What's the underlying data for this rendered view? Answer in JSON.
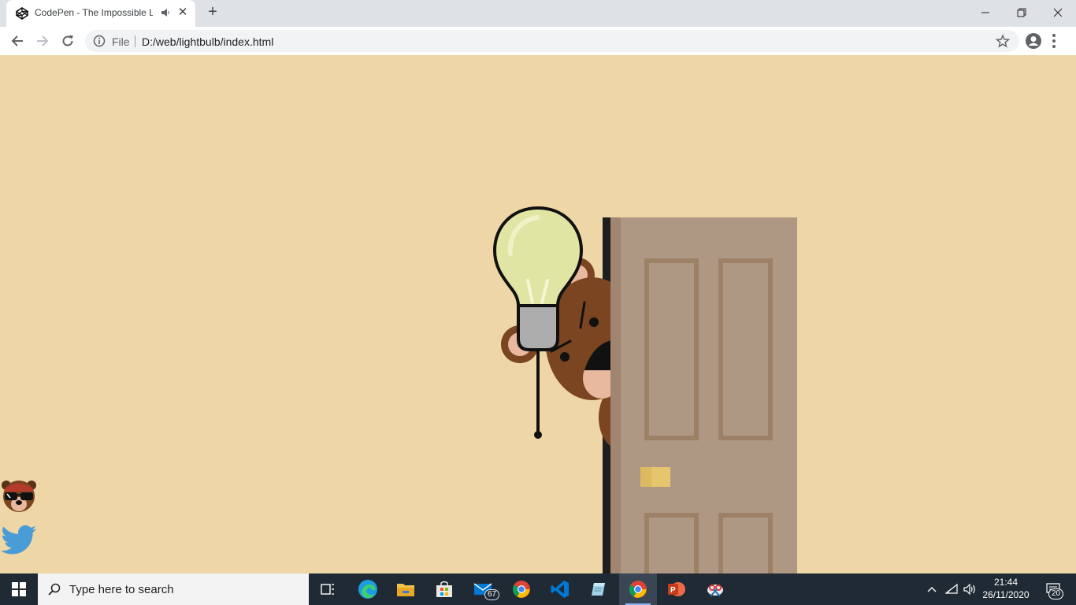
{
  "browser": {
    "tab_title": "CodePen - The Impossible Li",
    "scheme_label": "File",
    "url": "D:/web/lightbulb/index.html"
  },
  "page": {
    "background_color": "#efd6a7",
    "social_icons": [
      "bear-avatar-icon",
      "twitter-icon"
    ]
  },
  "taskbar": {
    "search_placeholder": "Type here to search",
    "mail_badge": "67",
    "clock_time": "21:44",
    "clock_date": "26/11/2020",
    "notification_count": "20",
    "apps": [
      "task-view-icon",
      "edge-icon",
      "file-explorer-icon",
      "store-icon",
      "mail-icon",
      "chrome-icon",
      "vscode-icon",
      "notepad-icon",
      "chrome-icon",
      "powerpoint-icon",
      "snipping-tool-icon"
    ]
  },
  "colors": {
    "door": "#ae9884",
    "door_frame": "#1e1e1e",
    "bear_fur": "#7a4520",
    "bulb_glass": "#e1e5a4",
    "taskbar": "#1f2a35"
  }
}
